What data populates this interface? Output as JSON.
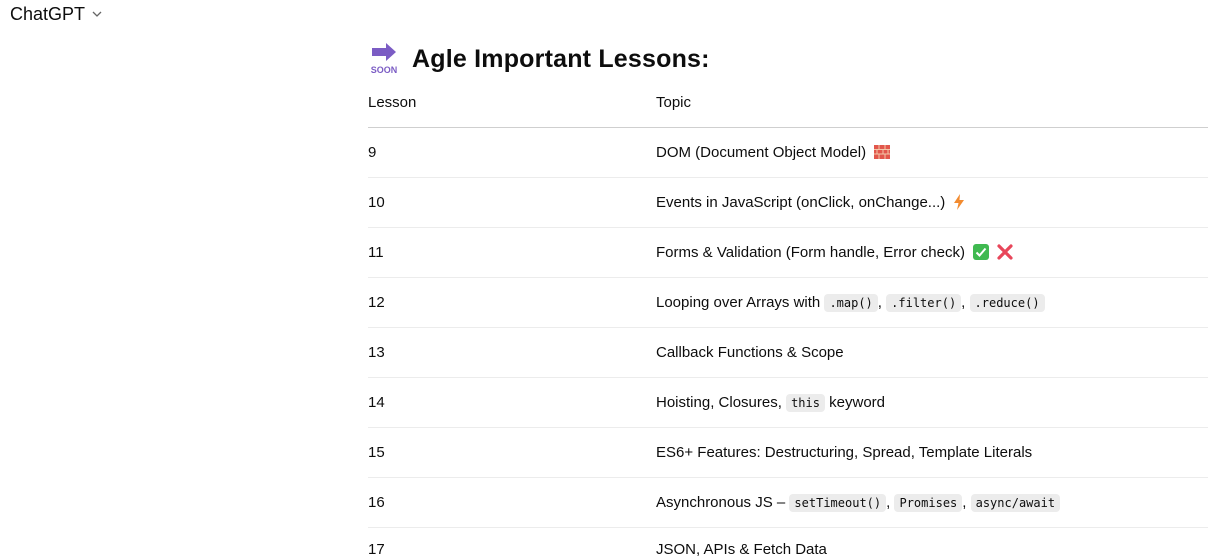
{
  "app": {
    "title": "ChatGPT"
  },
  "message": {
    "heading_icon": "soon-arrow-icon",
    "heading_icon_text": "SOON",
    "heading": "Agle Important Lessons:",
    "table": {
      "headers": [
        "Lesson",
        "Topic"
      ],
      "rows": [
        {
          "lesson": "9",
          "topic": "DOM (Document Object Model)",
          "emoji": "brick-icon"
        },
        {
          "lesson": "10",
          "topic": "Events in JavaScript (onClick, onChange...)",
          "emoji": "lightning-icon"
        },
        {
          "lesson": "11",
          "topic": "Forms & Validation (Form handle, Error check)",
          "emoji": "check-cross-icon"
        },
        {
          "lesson": "12",
          "parts": [
            "Looping over Arrays with",
            ".map()",
            ",",
            ".filter()",
            ",",
            ".reduce()"
          ]
        },
        {
          "lesson": "13",
          "topic": "Callback Functions & Scope"
        },
        {
          "lesson": "14",
          "parts": [
            "Hoisting, Closures,",
            "this",
            "keyword"
          ]
        },
        {
          "lesson": "15",
          "topic": "ES6+ Features: Destructuring, Spread, Template Literals"
        },
        {
          "lesson": "16",
          "parts": [
            "Asynchronous JS –",
            "setTimeout()",
            ",",
            "Promises",
            ",",
            "async/await"
          ]
        },
        {
          "lesson": "17",
          "topic": "JSON, APIs & Fetch Data"
        }
      ]
    }
  },
  "colors": {
    "soon_icon": "#7b5cc4",
    "brick": "#e2574c",
    "lightning": "#f28b30",
    "check": "#3fb950",
    "cross": "#e8465a"
  }
}
